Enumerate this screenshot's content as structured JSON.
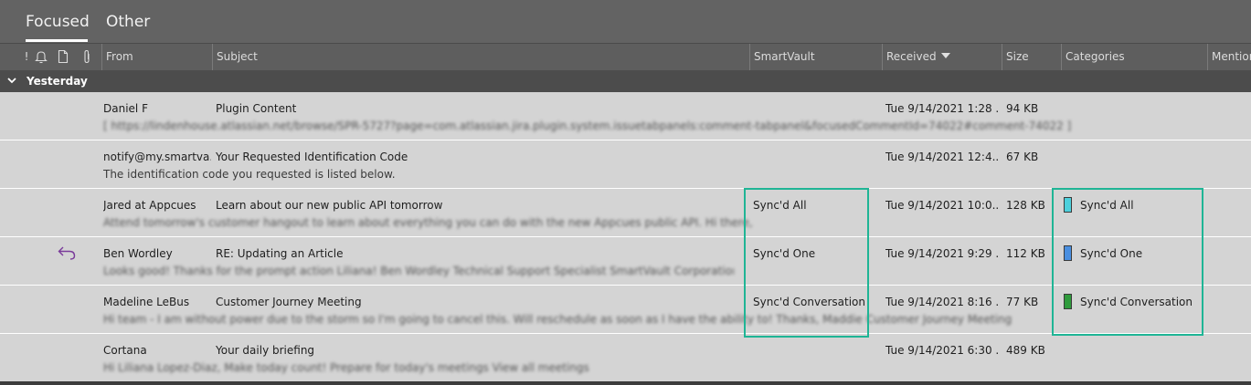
{
  "tabs": {
    "focused": "Focused",
    "other": "Other"
  },
  "columns": {
    "importance": "!",
    "from": "From",
    "subject": "Subject",
    "smartvault": "SmartVault",
    "received": "Received",
    "size": "Size",
    "categories": "Categories",
    "mention": "Mention"
  },
  "group": {
    "label": "Yesterday"
  },
  "colors": {
    "highlight": "#1fb595",
    "cat_synced_all": "#4dd0dc",
    "cat_synced_one": "#4a8fe0",
    "cat_synced_conversation": "#2f9b3c",
    "reply_icon": "#7a3b9a"
  },
  "messages": [
    {
      "from": "Daniel F",
      "subject": "Plugin Content",
      "smartvault": "",
      "received": "Tue 9/14/2021 1:28 ...",
      "size": "94 KB",
      "category": "",
      "preview": "[ https://lindenhouse.atlassian.net/browse/SPR-5727?page=com.atlassian.jira.plugin.system.issuetabpanels:comment-tabpanel&focusedCommentId=74022#comment-74022 ]"
    },
    {
      "from": "notify@my.smartva...",
      "subject": "Your Requested Identification Code",
      "smartvault": "",
      "received": "Tue 9/14/2021 12:4...",
      "size": "67 KB",
      "category": "",
      "preview": "The identification code you requested is listed below."
    },
    {
      "from": "Jared at Appcues",
      "subject": "Learn about our new public API tomorrow",
      "smartvault": "Sync'd All",
      "received": "Tue 9/14/2021 10:0...",
      "size": "128 KB",
      "category": "Sync'd All",
      "preview": "Attend tomorrow's customer hangout to learn about everything you can do with the new Appcues public API.  Hi there,"
    },
    {
      "from": "Ben Wordley",
      "subject": "RE: Updating an Article",
      "smartvault": "Sync'd One",
      "received": "Tue 9/14/2021 9:29 ...",
      "size": "112 KB",
      "category": "Sync'd One",
      "preview": "Looks good! Thanks for the prompt action Liliana!   Ben Wordley  Technical Support Specialist  SmartVault Corporation"
    },
    {
      "from": "Madeline LeBus",
      "subject": "Customer Journey Meeting",
      "smartvault": "Sync'd Conversation",
      "received": "Tue 9/14/2021 8:16 ...",
      "size": "77 KB",
      "category": "Sync'd Conversation",
      "preview": "Hi team - I am without power due to the storm so I'm going to cancel this. Will reschedule as soon as I have the ability to!  Thanks,  Maddie  Customer Journey Meeting"
    },
    {
      "from": "Cortana",
      "subject": "Your daily briefing",
      "smartvault": "",
      "received": "Tue 9/14/2021 6:30 ...",
      "size": "489 KB",
      "category": "",
      "preview": "Hi Liliana Lopez-Diaz,  Make today count!  Prepare for today's meetings  View all meetings"
    }
  ]
}
